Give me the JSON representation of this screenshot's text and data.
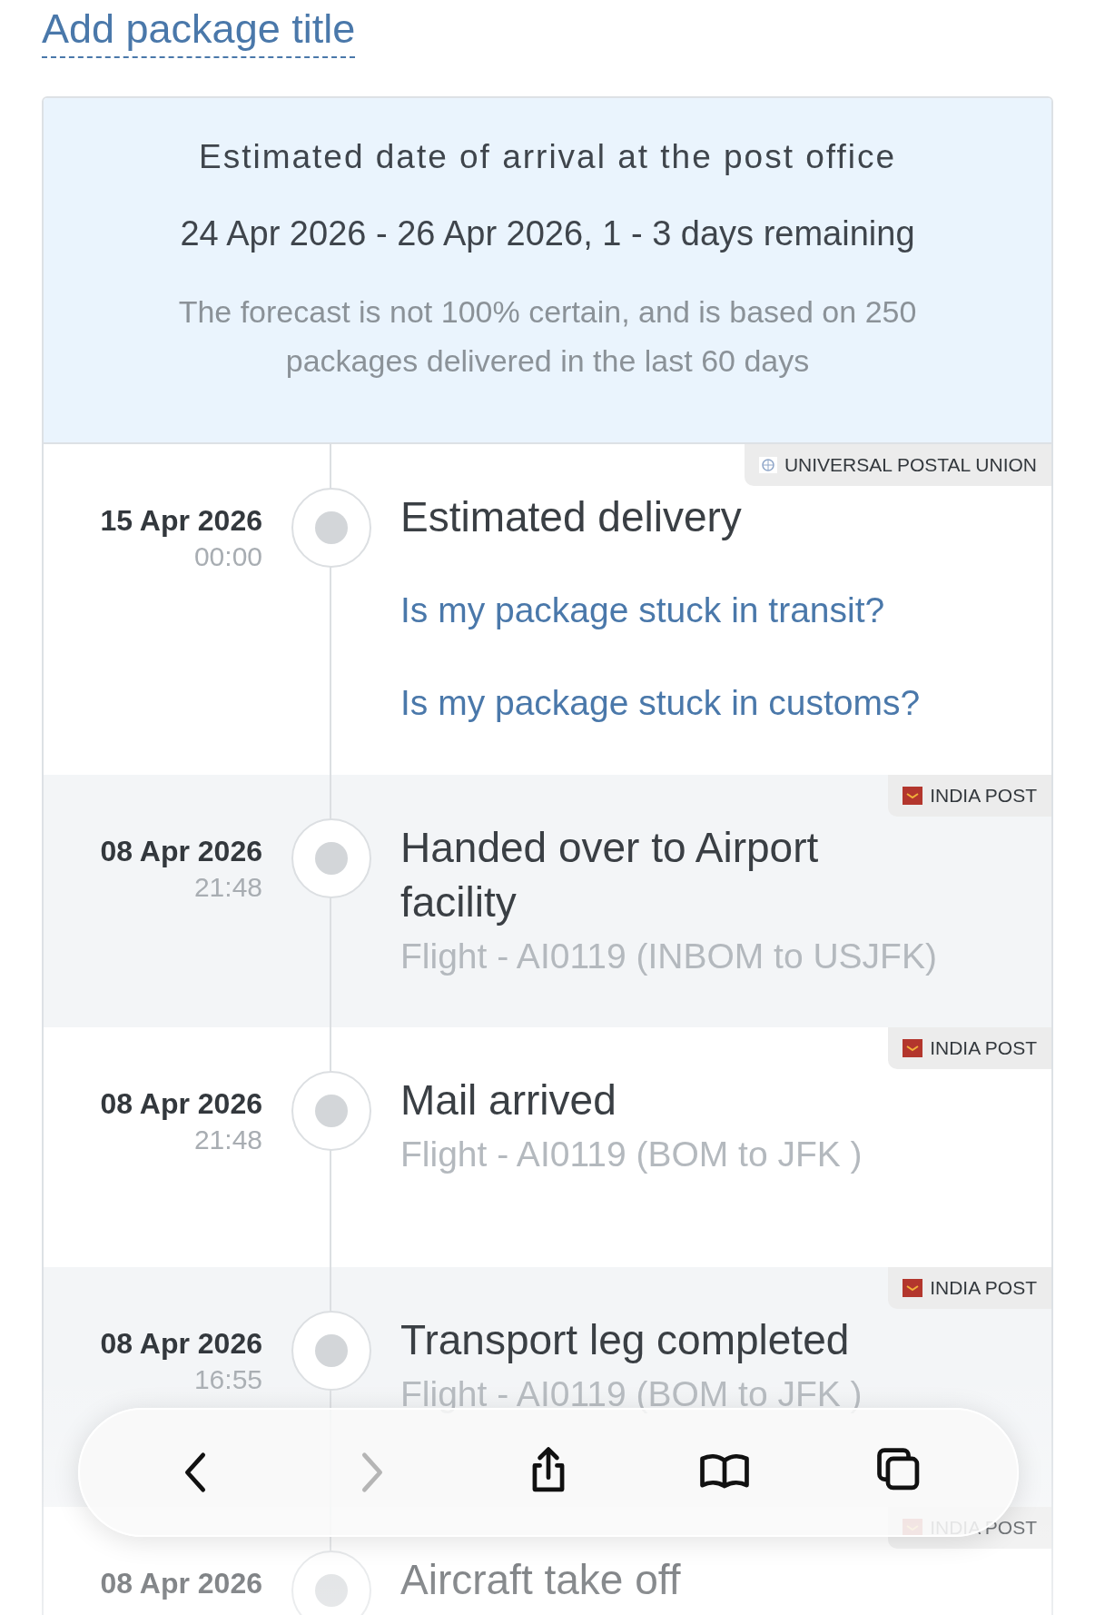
{
  "package_title": {
    "placeholder": "Add package title"
  },
  "estimate": {
    "heading": "Estimated date of arrival at the post office",
    "range": "24 Apr 2026 - 26 Apr 2026, 1 - 3 days remaining",
    "note": "The forecast is not 100% certain, and is based on 250 packages delivered in the last 60 days"
  },
  "events": [
    {
      "date": "15 Apr 2026",
      "time": "00:00",
      "title": "Estimated delivery",
      "links": [
        "Is my package stuck in transit?",
        "Is my package stuck in customs?"
      ],
      "carrier": {
        "name": "UNIVERSAL POSTAL UNION",
        "kind": "upu"
      }
    },
    {
      "date": "08 Apr 2026",
      "time": "21:48",
      "title": "Handed over to Airport facility",
      "detail": "Flight - AI0119 (INBOM to USJFK)",
      "carrier": {
        "name": "INDIA POST",
        "kind": "indiapost"
      }
    },
    {
      "date": "08 Apr 2026",
      "time": "21:48",
      "title": "Mail arrived",
      "detail": "Flight - AI0119 (BOM to JFK )",
      "carrier": {
        "name": "INDIA POST",
        "kind": "indiapost"
      }
    },
    {
      "date": "08 Apr 2026",
      "time": "16:55",
      "title": "Transport leg completed",
      "detail": "Flight - AI0119 (BOM to JFK )",
      "carrier": {
        "name": "INDIA POST",
        "kind": "indiapost"
      }
    },
    {
      "date": "08 Apr 2026",
      "title": "Aircraft take off",
      "carrier": {
        "name": "INDIA POST",
        "kind": "indiapost"
      }
    }
  ],
  "toolbar": [
    {
      "kind": "back",
      "disabled": false
    },
    {
      "kind": "forward",
      "disabled": true
    },
    {
      "kind": "share",
      "disabled": false
    },
    {
      "kind": "bookmarks",
      "disabled": false
    },
    {
      "kind": "tabs",
      "disabled": false
    }
  ]
}
